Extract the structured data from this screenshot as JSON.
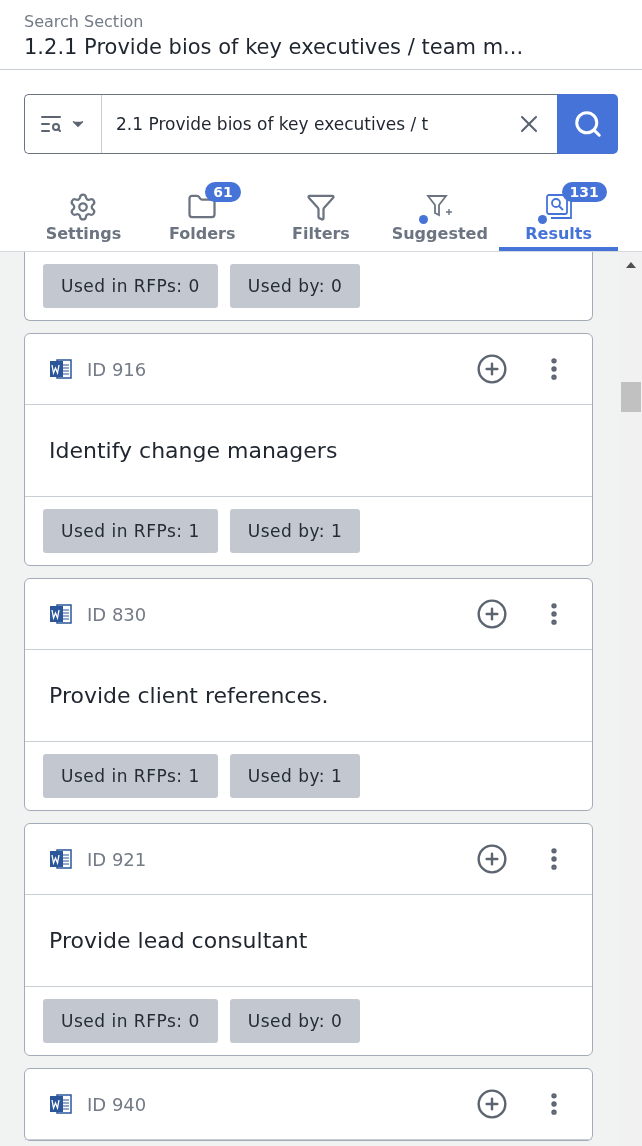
{
  "header": {
    "caption": "Search Section",
    "title": "1.2.1 Provide bios of key executives / team m..."
  },
  "search": {
    "value": "2.1 Provide bios of key executives / t"
  },
  "tabs": [
    {
      "kind": "settings",
      "label": "Settings",
      "selected": false,
      "indicator": false
    },
    {
      "kind": "folders",
      "label": "Folders",
      "badge": "61",
      "selected": false,
      "indicator": false
    },
    {
      "kind": "filters",
      "label": "Filters",
      "selected": false,
      "indicator": false
    },
    {
      "kind": "suggested",
      "label": "Suggested",
      "selected": false,
      "indicator": true
    },
    {
      "kind": "results",
      "label": "Results",
      "badge": "131",
      "selected": true,
      "indicator": true
    }
  ],
  "partial_card": {
    "tags": [
      "Used in RFPs: 0",
      "Used by: 0"
    ]
  },
  "results": [
    {
      "id": "ID 916",
      "title": "Identify change managers",
      "tags": [
        "Used in RFPs: 1",
        "Used by: 1"
      ]
    },
    {
      "id": "ID 830",
      "title": "Provide client references.",
      "tags": [
        "Used in RFPs: 1",
        "Used by: 1"
      ]
    },
    {
      "id": "ID 921",
      "title": "Provide lead consultant",
      "tags": [
        "Used in RFPs: 0",
        "Used by: 0"
      ]
    },
    {
      "id": "ID 940"
    }
  ]
}
